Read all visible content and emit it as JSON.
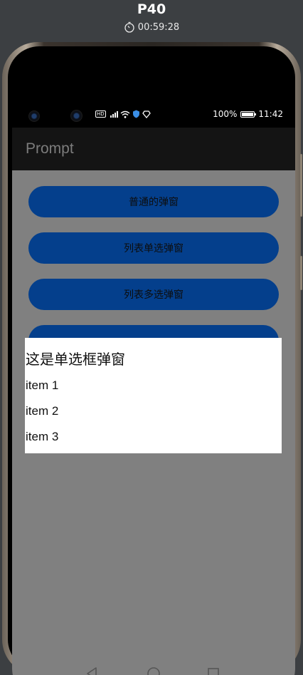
{
  "header": {
    "device_name": "P40",
    "timer": "00:59:28"
  },
  "status_bar": {
    "battery_percent": "100%",
    "time": "11:42",
    "hd_label": "HD"
  },
  "app_bar": {
    "title": "Prompt"
  },
  "buttons": [
    {
      "label": "普通的弹窗"
    },
    {
      "label": "列表单选弹窗"
    },
    {
      "label": "列表多选弹窗"
    }
  ],
  "dialog": {
    "title": "这是单选框弹窗",
    "items": [
      "item 1",
      "item 2",
      "item 3"
    ]
  },
  "icons": {
    "timer": "stopwatch-icon",
    "wifi": "wifi-icon",
    "signal": "signal-icon",
    "battery": "battery-icon",
    "back": "back-triangle-icon",
    "home": "home-circle-icon",
    "recents": "recents-square-icon"
  },
  "colors": {
    "button_bg": "#043f8c",
    "overlay": "#808080",
    "dialog_bg": "#ffffff",
    "app_bar_bg": "#141414"
  }
}
